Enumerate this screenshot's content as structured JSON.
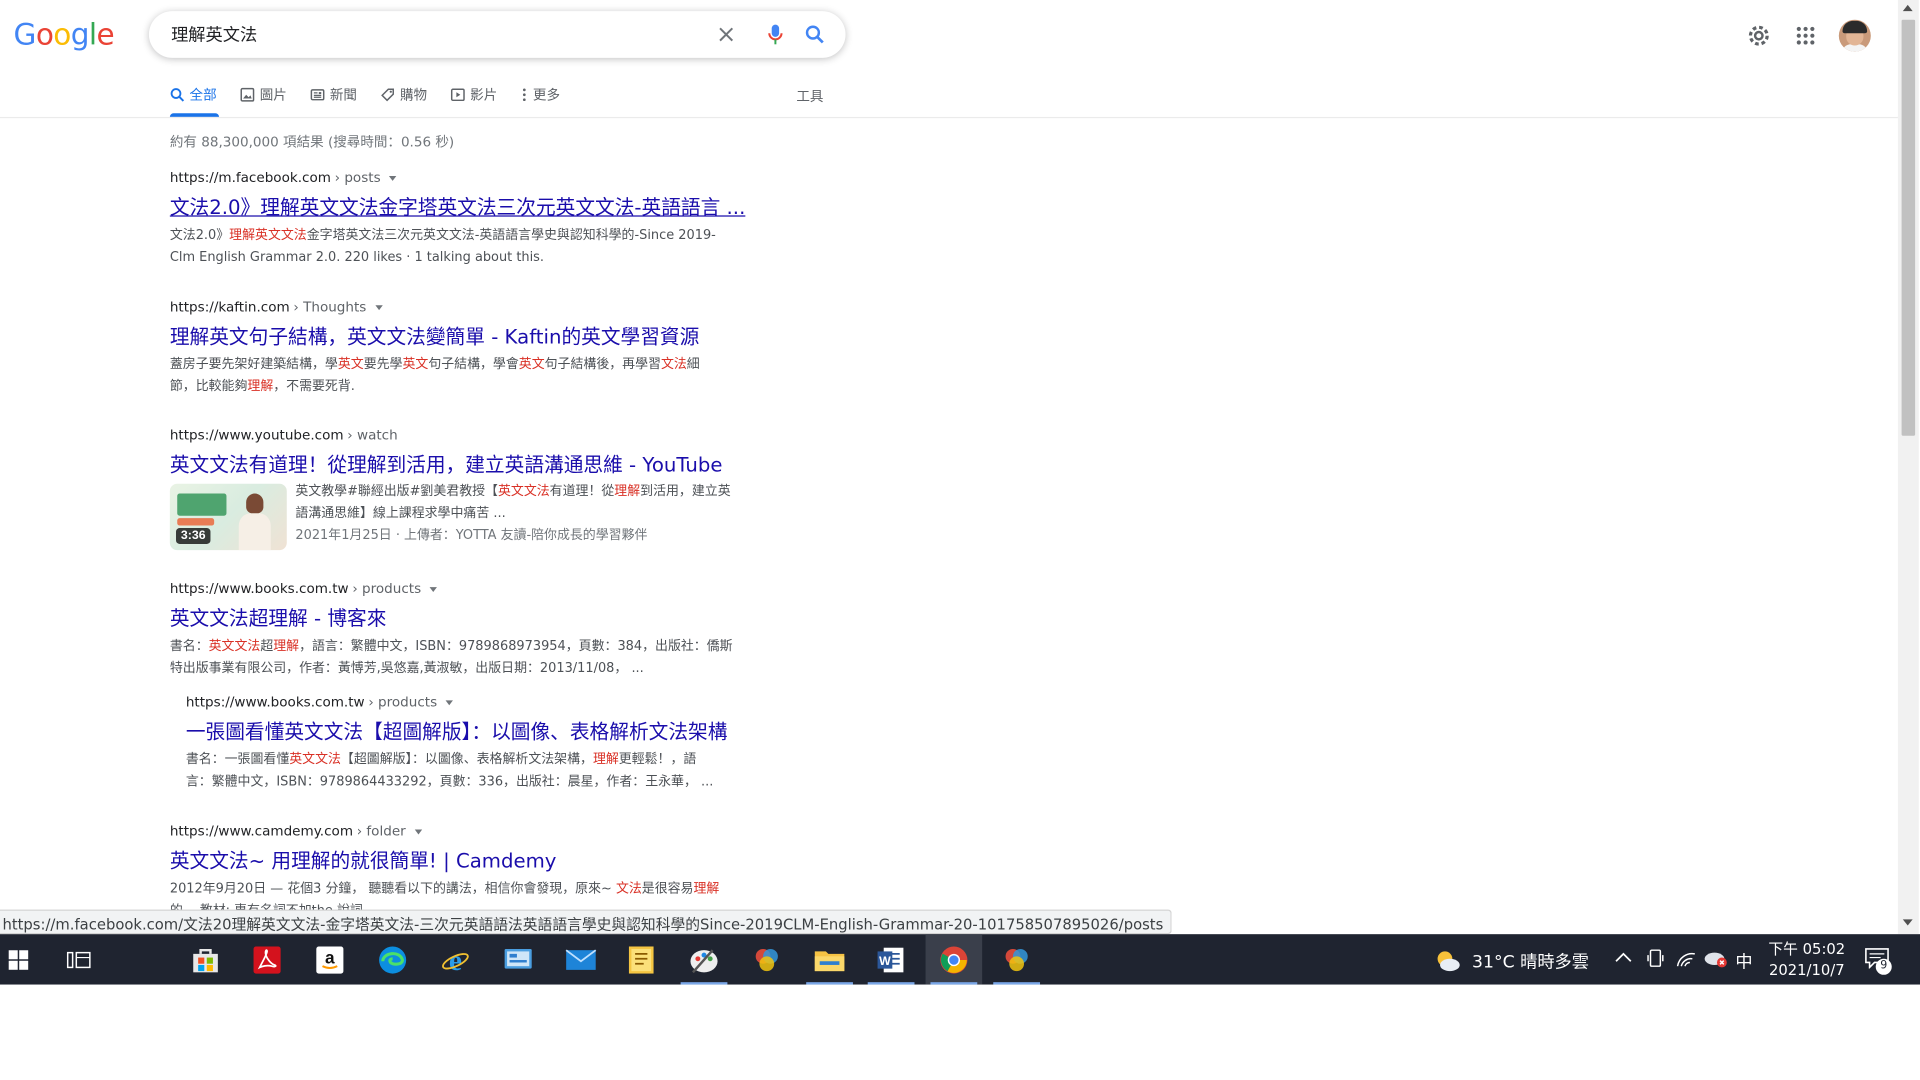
{
  "search": {
    "query": "理解英文法"
  },
  "tabs": [
    {
      "label": "全部",
      "icon": "search-icon",
      "active": true
    },
    {
      "label": "圖片",
      "icon": "image-icon"
    },
    {
      "label": "新聞",
      "icon": "news-icon"
    },
    {
      "label": "購物",
      "icon": "tag-icon"
    },
    {
      "label": "影片",
      "icon": "play-icon"
    },
    {
      "label": "更多",
      "icon": "more-vert-icon"
    }
  ],
  "tools_label": "工具",
  "stats": "約有 88,300,000 項結果 (搜尋時間：0.56 秒)",
  "results": [
    {
      "domain": "https://m.facebook.com",
      "path": "› posts",
      "title": "文法2.0》理解英文文法金字塔英文法三次元英文文法-英語語言 ...",
      "snippet_parts": [
        [
          "文法2.0》",
          false
        ],
        [
          "理解英文文法",
          true
        ],
        [
          "金字塔英文法三次元英文文法-英語語言學史與認知科學的-Since 2019-",
          false
        ]
      ],
      "snippet_line2": "Clm English Grammar 2.0. 220 likes · 1 talking about this."
    },
    {
      "domain": "https://kaftin.com",
      "path": "› Thoughts",
      "title": "理解英文句子結構，英文文法變簡單 - Kaftin的英文學習資源",
      "snippet_parts": [
        [
          "蓋房子要先架好建築結構，學",
          false
        ],
        [
          "英文",
          true
        ],
        [
          "要先學",
          false
        ],
        [
          "英文",
          true
        ],
        [
          "句子結構，學會",
          false
        ],
        [
          "英文",
          true
        ],
        [
          "句子結構後，再學習",
          false
        ],
        [
          "文法",
          true
        ],
        [
          "細",
          false
        ]
      ],
      "snippet_line2_parts": [
        [
          "節，比較能夠",
          false
        ],
        [
          "理解",
          true
        ],
        [
          "，不需要死背.",
          false
        ]
      ]
    },
    {
      "domain": "https://www.youtube.com",
      "path": "› watch",
      "title": "英文文法有道理！從理解到活用，建立英語溝通思維 - YouTube",
      "duration": "3:36",
      "snippet_parts": [
        [
          "英文教學#聯經出版#劉美君教授【",
          false
        ],
        [
          "英文文法",
          true
        ],
        [
          "有道理！從",
          false
        ],
        [
          "理解",
          true
        ],
        [
          "到活用，建立英",
          false
        ]
      ],
      "snippet_line2": "語溝通思維】線上課程求學中痛苦 ...",
      "meta": "2021年1月25日 · 上傳者：YOTTA 友讀-陪你成長的學習夥伴"
    },
    {
      "domain": "https://www.books.com.tw",
      "path": "› products",
      "title": "英文文法超理解 - 博客來",
      "snippet_parts": [
        [
          "書名：",
          false
        ],
        [
          "英文文法",
          true
        ],
        [
          "超",
          false
        ],
        [
          "理解",
          true
        ],
        [
          "，語言：繁體中文，ISBN：9789868973954，頁數：384，出版社：僑斯",
          false
        ]
      ],
      "snippet_line2": "特出版事業有限公司，作者：黃愽芳,吳悠嘉,黃淑敏，出版日期：2013/11/08，  ..."
    },
    {
      "domain": "https://www.books.com.tw",
      "path": "› products",
      "title": "一張圖看懂英文文法【超圖解版】：以圖像、表格解析文法架構",
      "snippet_parts": [
        [
          "書名：一張圖看懂",
          false
        ],
        [
          "英文文法",
          true
        ],
        [
          "【超圖解版】：以圖像、表格解析文法架構，",
          false
        ],
        [
          "理解",
          true
        ],
        [
          "更輕鬆！，語",
          false
        ]
      ],
      "snippet_line2": "言：繁體中文，ISBN：9789864433292，頁數：336，出版社：晨星，作者：王永華，  ..."
    },
    {
      "domain": "https://www.camdemy.com",
      "path": "› folder",
      "title": "英文文法~ 用理解的就很簡單! | Camdemy",
      "snippet_parts": [
        [
          "2012年9月20日 — 花個3 分鐘， 聽聽看以下的講法，相信你會發現，原來~ ",
          false
        ],
        [
          "文法",
          true
        ],
        [
          "是很容易",
          false
        ],
        [
          "理解",
          true
        ]
      ],
      "snippet_line2": "的。 教材: 專有名詞不加the 說詞 ..."
    }
  ],
  "status_url": "https://m.facebook.com/文法20理解英文文法-金字塔英文法-三次元英語語法英語語言學史與認知科學的Since-2019CLM-English-Grammar-20-101758507895026/posts",
  "taskbar": {
    "weather": "31°C  晴時多雲",
    "ime": "中",
    "time": "下午 05:02",
    "date": "2021/10/7",
    "notifications": "9"
  }
}
